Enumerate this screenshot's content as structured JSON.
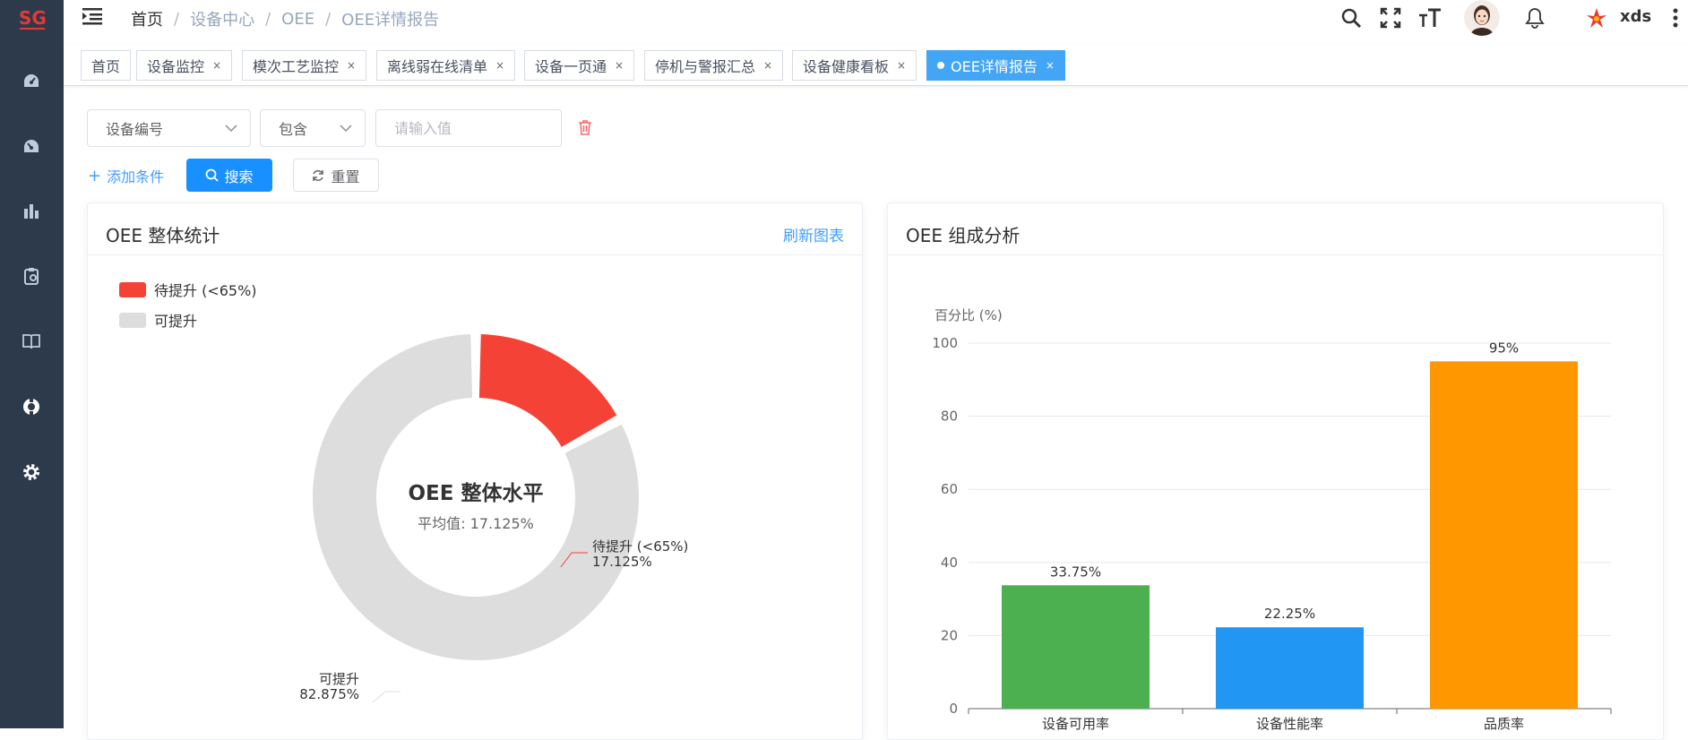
{
  "app": {
    "logo_text": "SG",
    "user_name": "xds"
  },
  "breadcrumb": {
    "home": "首页",
    "items": [
      "设备中心",
      "OEE",
      "OEE详情报告"
    ]
  },
  "tags": [
    {
      "label": "首页",
      "closable": false,
      "active": false
    },
    {
      "label": "设备监控",
      "closable": true,
      "active": false
    },
    {
      "label": "模次工艺监控",
      "closable": true,
      "active": false
    },
    {
      "label": "离线弱在线清单",
      "closable": true,
      "active": false
    },
    {
      "label": "设备一页通",
      "closable": true,
      "active": false
    },
    {
      "label": "停机与警报汇总",
      "closable": true,
      "active": false
    },
    {
      "label": "设备健康看板",
      "closable": true,
      "active": false
    },
    {
      "label": "OEE详情报告",
      "closable": true,
      "active": true
    }
  ],
  "tag_close_glyph": "×",
  "filter": {
    "field_select": "设备编号",
    "operator_select": "包含",
    "value_placeholder": "请输入值",
    "value": "",
    "add_condition": "添加条件",
    "search_button": "搜索",
    "reset_button": "重置"
  },
  "overall_card": {
    "title": "OEE 整体统计",
    "refresh_link": "刷新图表",
    "center_title": "OEE 整体水平",
    "center_subtitle": "平均值: 17.125%",
    "legend": [
      {
        "label": "待提升 (<65%)",
        "color": "#f44336"
      },
      {
        "label": "可提升",
        "color": "#dddddd"
      }
    ],
    "slice_labels": [
      {
        "name": "待提升 (<65%)",
        "value": "17.125%"
      },
      {
        "name": "可提升",
        "value": "82.875%"
      }
    ]
  },
  "composition_card": {
    "title": "OEE 组成分析"
  },
  "chart_data": [
    {
      "type": "pie",
      "subtype": "donut",
      "title": "OEE 整体统计",
      "categories": [
        "待提升 (<65%)",
        "可提升"
      ],
      "values": [
        17.125,
        82.875
      ],
      "colors": [
        "#f44336",
        "#dddddd"
      ],
      "legend_position": "top-left"
    },
    {
      "type": "bar",
      "title": "OEE 组成分析",
      "ylabel": "百分比 (%)",
      "categories": [
        "设备可用率",
        "设备性能率",
        "品质率"
      ],
      "values": [
        33.75,
        22.25,
        95
      ],
      "value_labels": [
        "33.75%",
        "22.25%",
        "95%"
      ],
      "colors": [
        "#4caf50",
        "#2196f3",
        "#ff9800"
      ],
      "ylim": [
        0,
        100
      ],
      "yticks": [
        "0",
        "20",
        "40",
        "60",
        "80",
        "100"
      ],
      "grid": true
    }
  ]
}
